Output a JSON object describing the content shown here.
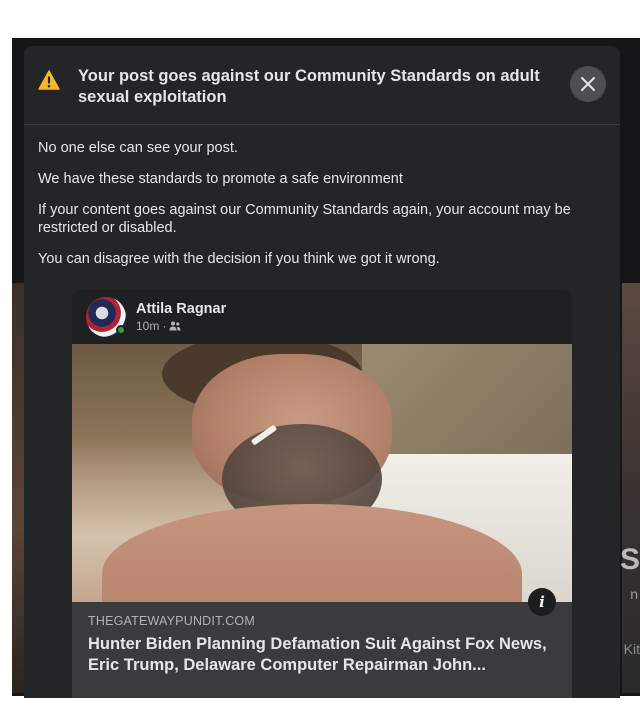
{
  "background": {
    "right_edge_large_text": "S",
    "right_edge_small_text": "n",
    "right_edge_lower_text": "Kit"
  },
  "modal": {
    "title": "Your post goes against our Community Standards on adult sexual exploitation",
    "warning_icon": "warning-triangle-icon",
    "close_icon": "close-icon",
    "paragraphs": [
      "No one else can see your post.",
      "We have these standards to promote a safe environment",
      "If your content goes against our Community Standards again, your account may be restricted or disabled.",
      "You can disagree with the decision if you think we got it wrong."
    ]
  },
  "post": {
    "author": "Attila Ragnar",
    "time": "10m",
    "separator": "·",
    "audience_icon": "friends-icon",
    "info_icon_label": "i",
    "link": {
      "domain": "THEGATEWAYPUNDIT.COM",
      "title": "Hunter Biden Planning Defamation Suit Against Fox News, Eric Trump, Delaware Computer Repairman John..."
    }
  },
  "colors": {
    "modal_bg": "#242526",
    "warning": "#f7b928",
    "online": "#31a24c"
  }
}
